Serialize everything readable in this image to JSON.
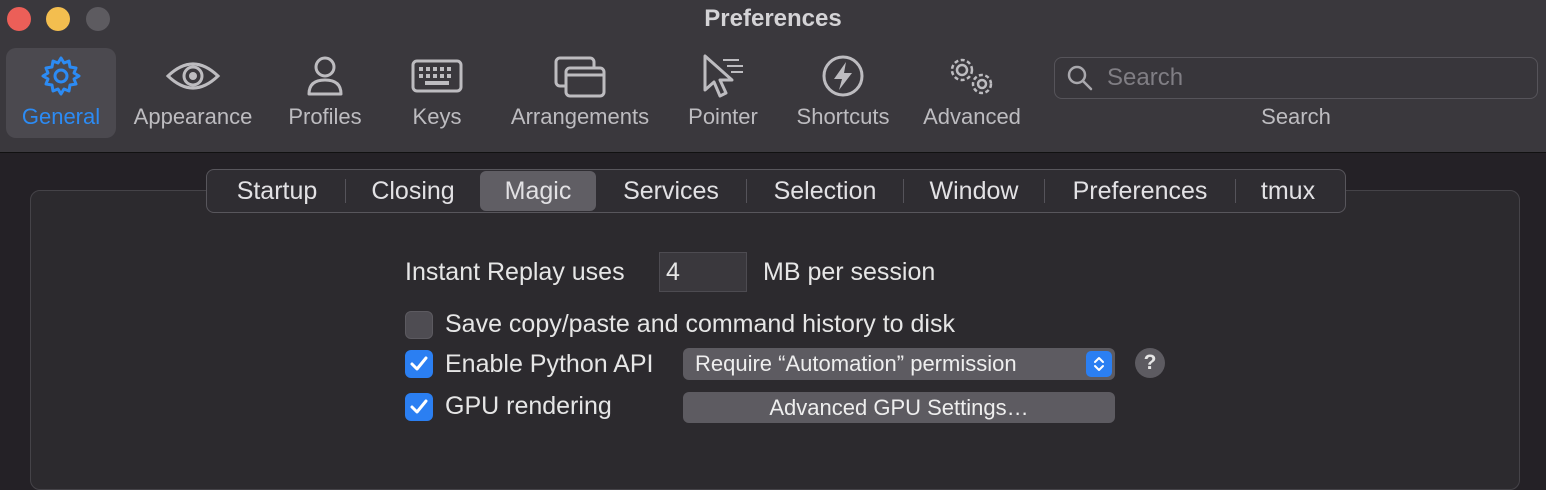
{
  "window": {
    "title": "Preferences"
  },
  "toolbar": {
    "items": [
      {
        "label": "General",
        "icon": "gear-icon",
        "selected": true
      },
      {
        "label": "Appearance",
        "icon": "eye-icon"
      },
      {
        "label": "Profiles",
        "icon": "person-icon"
      },
      {
        "label": "Keys",
        "icon": "keyboard-icon"
      },
      {
        "label": "Arrangements",
        "icon": "windows-icon"
      },
      {
        "label": "Pointer",
        "icon": "pointer-icon"
      },
      {
        "label": "Shortcuts",
        "icon": "lightning-icon"
      },
      {
        "label": "Advanced",
        "icon": "gears-icon"
      }
    ],
    "search": {
      "placeholder": "Search",
      "label": "Search",
      "value": ""
    }
  },
  "tabs": {
    "items": [
      "Startup",
      "Closing",
      "Magic",
      "Services",
      "Selection",
      "Window",
      "Preferences",
      "tmux"
    ],
    "selected": "Magic"
  },
  "magic": {
    "instant_replay": {
      "label_before": "Instant Replay uses",
      "value": "4",
      "label_after": "MB per session"
    },
    "save_history": {
      "label": "Save copy/paste and command history to disk",
      "checked": false
    },
    "python_api": {
      "label": "Enable Python API",
      "checked": true,
      "permission_selected": "Require “Automation” permission",
      "help": "?"
    },
    "gpu_rendering": {
      "label": "GPU rendering",
      "checked": true,
      "button": "Advanced GPU Settings…"
    }
  },
  "colors": {
    "accent": "#2c8bf4",
    "checkbox_on": "#2b7ff2"
  }
}
